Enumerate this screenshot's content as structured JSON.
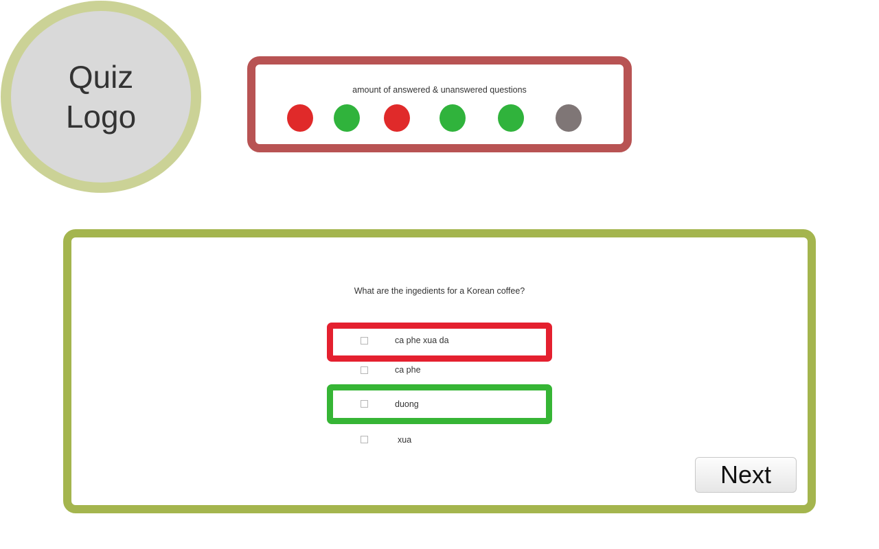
{
  "logo": {
    "text": "Quiz\nLogo"
  },
  "progress": {
    "label": "amount of answered & unanswered questions",
    "questions": [
      {
        "status": "wrong",
        "color": "#e02a2a"
      },
      {
        "status": "correct",
        "color": "#30b33c"
      },
      {
        "status": "wrong",
        "color": "#e02a2a"
      },
      {
        "status": "correct",
        "color": "#30b33c"
      },
      {
        "status": "correct",
        "color": "#30b33c"
      },
      {
        "status": "unanswered",
        "color": "#7f7676"
      }
    ]
  },
  "question": {
    "text": "What are the ingedients for a Korean coffee?",
    "answers": [
      {
        "label": "ca phe xua da",
        "checked": false,
        "feedback": "wrong"
      },
      {
        "label": "ca phe",
        "checked": false,
        "feedback": "none"
      },
      {
        "label": "duong",
        "checked": false,
        "feedback": "correct"
      },
      {
        "label": "xua",
        "checked": false,
        "feedback": "none"
      }
    ]
  },
  "navigation": {
    "next_label": "Next"
  },
  "colors": {
    "logo_ring": "#cbd296",
    "logo_fill": "#d9d9d9",
    "progress_border": "#b85353",
    "question_border": "#a4b54e",
    "wrong": "#e4202f",
    "correct": "#36b535"
  }
}
